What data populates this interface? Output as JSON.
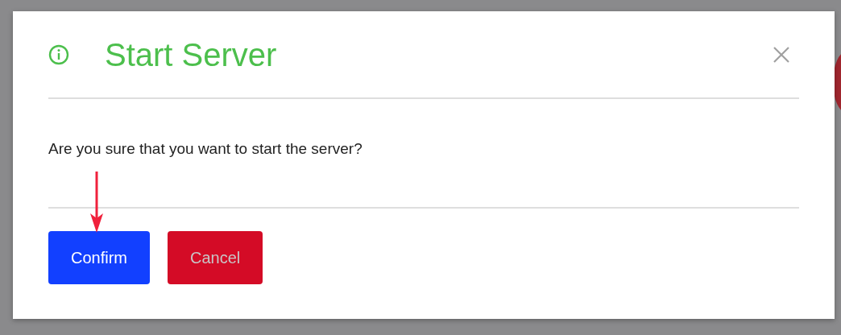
{
  "dialog": {
    "title": "Start Server",
    "message": "Are you sure that you want to start the server?",
    "buttons": [
      {
        "label": "Confirm",
        "kind": "primary"
      },
      {
        "label": "Cancel",
        "kind": "danger"
      }
    ],
    "annotation": {
      "kind": "arrow"
    }
  }
}
